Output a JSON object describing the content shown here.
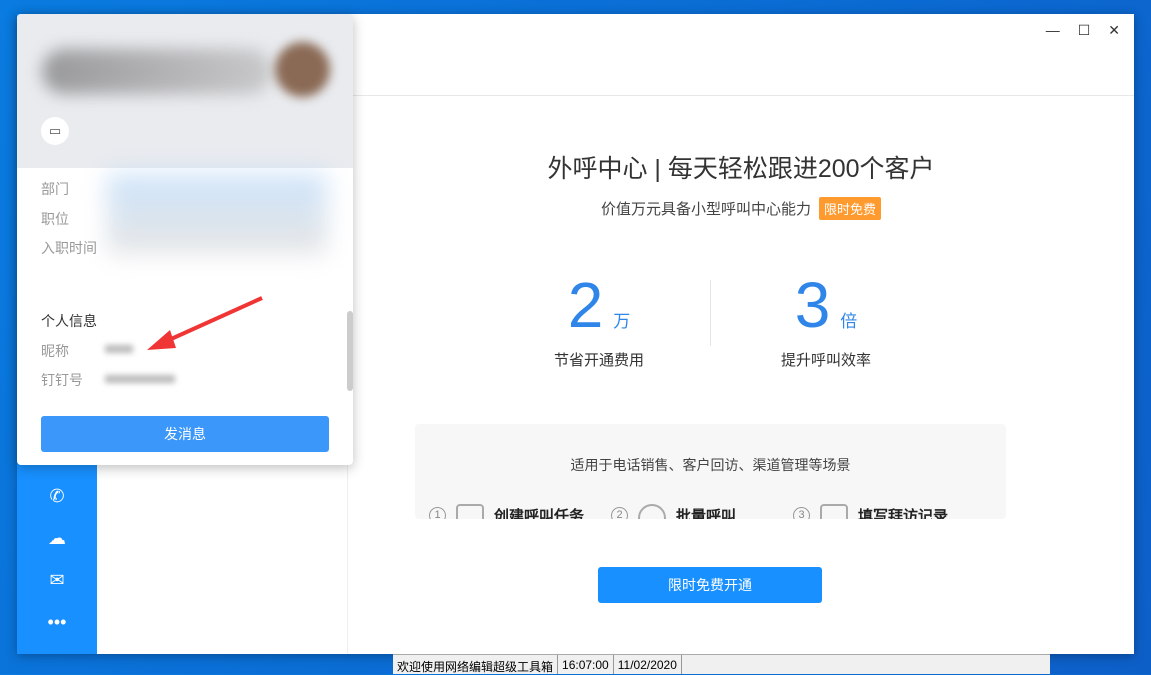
{
  "window": {
    "controls": [
      "—",
      "☐",
      "✕"
    ]
  },
  "main": {
    "title": "外呼中心 | 每天轻松跟进200个客户",
    "subtitle": "价值万元具备小型呼叫中心能力",
    "badge": "限时免费",
    "stats": [
      {
        "value": "2",
        "unit": "万",
        "label": "节省开通费用"
      },
      {
        "value": "3",
        "unit": "倍",
        "label": "提升呼叫效率"
      }
    ],
    "scenario": "适用于电话销售、客户回访、渠道管理等场景",
    "steps": [
      {
        "n": "1",
        "label": "创建呼叫任务"
      },
      {
        "n": "2",
        "label": "批量呼叫"
      },
      {
        "n": "3",
        "label": "填写拜访记录"
      }
    ],
    "cta": "限时免费开通"
  },
  "popup": {
    "fields": [
      "部门",
      "职位",
      "入职时间"
    ],
    "section": "个人信息",
    "personal": [
      "昵称",
      "钉钉号"
    ],
    "send": "发消息"
  },
  "statusbar": {
    "message": "欢迎使用网络编辑超级工具箱",
    "time": "16:07:00",
    "date": "11/02/2020"
  },
  "colors": {
    "accent": "#1890ff",
    "stat": "#2f86e8",
    "badge": "#ff9a2e"
  }
}
